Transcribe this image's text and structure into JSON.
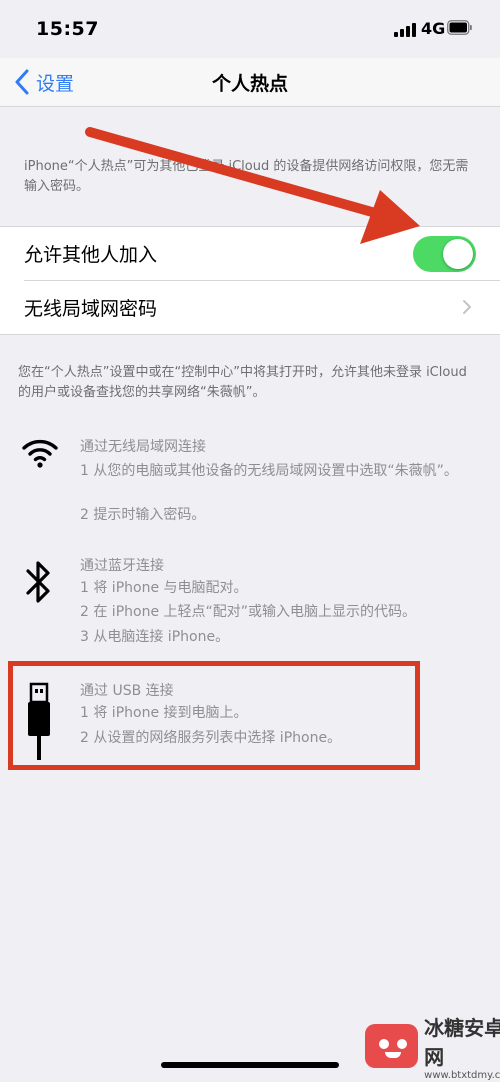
{
  "status": {
    "time": "15:57",
    "network": "4G"
  },
  "nav": {
    "back_label": "设置",
    "title": "个人热点"
  },
  "description": "iPhone“个人热点”可为其他已登录 iCloud 的设备提供网络访问权限，您无需输入密码。",
  "settings": {
    "allow_others_label": "允许其他人加入",
    "allow_others_on": true,
    "wifi_password_label": "无线局域网密码"
  },
  "footer_info": "您在“个人热点”设置中或在“控制中心”中将其打开时，允许其他未登录 iCloud 的用户或设备查找您的共享网络“朱薇帆”。",
  "methods": {
    "wifi": {
      "icon": "wifi-icon",
      "title": "通过无线局域网连接",
      "steps": [
        "1 从您的电脑或其他设备的无线局域网设置中选取“朱薇帆”。",
        "2 提示时输入密码。"
      ]
    },
    "bluetooth": {
      "icon": "bluetooth-icon",
      "title": "通过蓝牙连接",
      "steps": [
        "1 将 iPhone 与电脑配对。",
        "2 在 iPhone 上轻点“配对”或输入电脑上显示的代码。",
        "3 从电脑连接 iPhone。"
      ]
    },
    "usb": {
      "icon": "usb-cable-icon",
      "title": "通过 USB 连接",
      "steps": [
        "1 将 iPhone 接到电脑上。",
        "2 从设置的网络服务列表中选择 iPhone。"
      ]
    }
  },
  "watermark": {
    "name": "冰糖安卓网",
    "url": "www.btxtdmy.com"
  },
  "colors": {
    "accent": "#2f7cf6",
    "toggle_on": "#4cd964",
    "annotation_red": "#d83a22"
  }
}
